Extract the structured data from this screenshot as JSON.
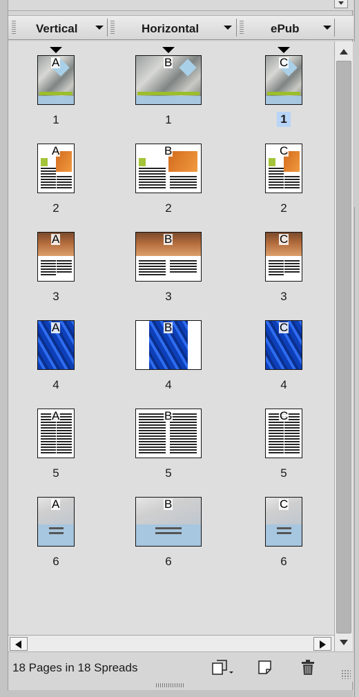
{
  "columns": [
    {
      "label": "Vertical",
      "letter": "A"
    },
    {
      "label": "Horizontal",
      "letter": "B"
    },
    {
      "label": "ePub",
      "letter": "C"
    }
  ],
  "rows": [
    {
      "page": "1",
      "kind": "cover"
    },
    {
      "page": "2",
      "kind": "article"
    },
    {
      "page": "3",
      "kind": "room"
    },
    {
      "page": "4",
      "kind": "blue"
    },
    {
      "page": "5",
      "kind": "text"
    },
    {
      "page": "6",
      "kind": "paper"
    }
  ],
  "selected_page": {
    "column": "ePub",
    "page": "1"
  },
  "status": {
    "text": "18 Pages in 18 Spreads"
  },
  "icons": {
    "page_size": "page-size-icon",
    "new_page": "new-page-icon",
    "delete": "trash-icon"
  },
  "colors": {
    "selection": "#b8d4f6",
    "panel": "#d6d6d6"
  }
}
